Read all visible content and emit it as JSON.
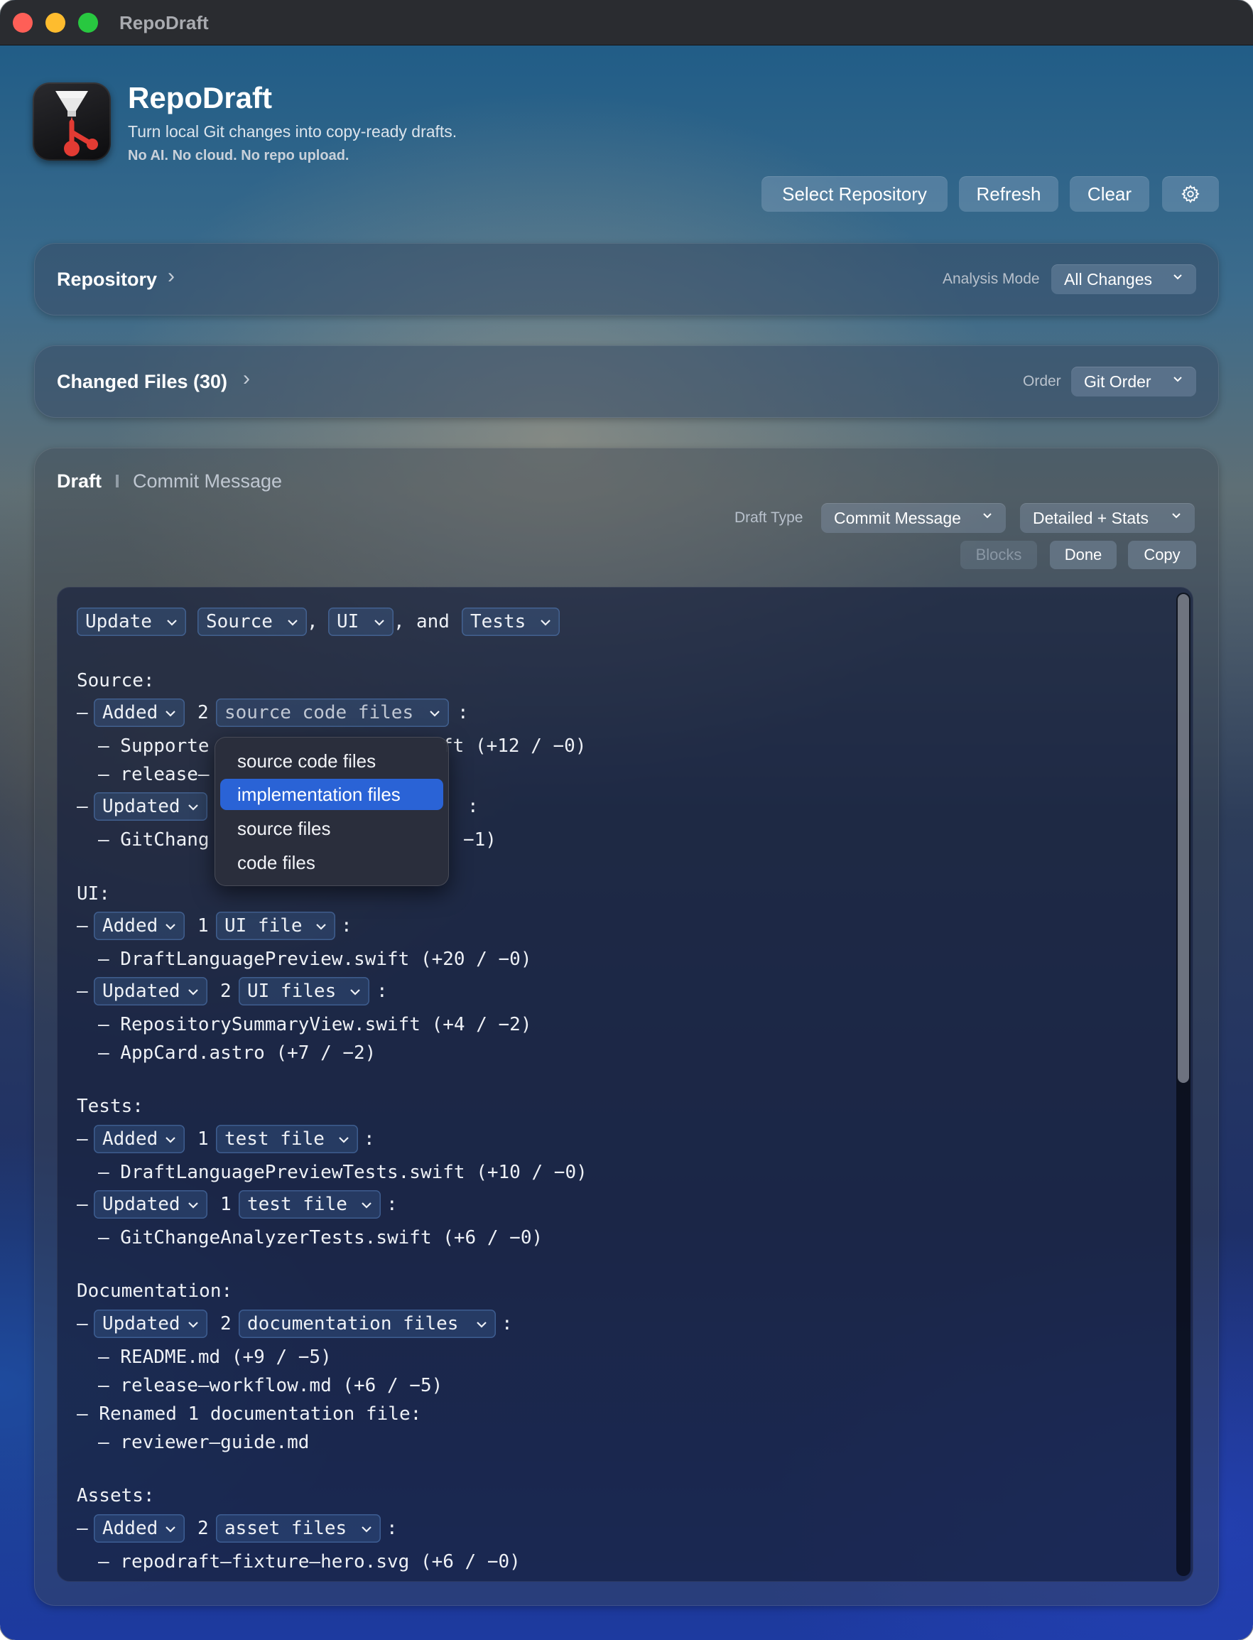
{
  "window": {
    "title": "RepoDraft"
  },
  "header": {
    "app_name": "RepoDraft",
    "tagline": "Turn local Git changes into copy-ready drafts.",
    "subtagline": "No AI. No cloud. No repo upload.",
    "buttons": {
      "select_repository": "Select Repository",
      "refresh": "Refresh",
      "clear": "Clear",
      "settings_icon": "gear-icon"
    }
  },
  "repository": {
    "title": "Repository",
    "analysis_mode_label": "Analysis Mode",
    "analysis_mode_value": "All Changes"
  },
  "changed_files": {
    "title": "Changed Files (30)",
    "order_label": "Order",
    "order_value": "Git Order"
  },
  "draft": {
    "title": "Draft",
    "subtitle": "Commit Message",
    "draft_type_label": "Draft Type",
    "draft_type_value": "Commit Message",
    "detail_value": "Detailed + Stats",
    "buttons": {
      "blocks": "Blocks",
      "done": "Done",
      "copy": "Copy"
    }
  },
  "editor": {
    "summary": {
      "verb": "Update",
      "t1": "Source",
      "c1": ",",
      "t2": "UI",
      "c2": ",",
      "and": "and",
      "t3": "Tests"
    },
    "source": {
      "heading": "Source:",
      "added": {
        "dash": "–",
        "verb": "Added",
        "count": "2",
        "kind": "source code files",
        "colon": ":"
      },
      "added_files": [
        "– Supporte",
        "ft (+12 / −0)",
        "– release–"
      ],
      "updated": {
        "dash": "–",
        "verb": "Updated",
        "colon": ":"
      },
      "updated_files": [
        "– GitChang",
        "−1)"
      ]
    },
    "ui": {
      "heading": "UI:",
      "added": {
        "dash": "–",
        "verb": "Added",
        "count": "1",
        "kind": "UI file",
        "colon": ":"
      },
      "added_files": [
        "– DraftLanguagePreview.swift (+20 / −0)"
      ],
      "updated": {
        "dash": "–",
        "verb": "Updated",
        "count": "2",
        "kind": "UI files",
        "colon": ":"
      },
      "updated_files": [
        "– RepositorySummaryView.swift (+4 / −2)",
        "– AppCard.astro (+7 / −2)"
      ]
    },
    "tests": {
      "heading": "Tests:",
      "added": {
        "dash": "–",
        "verb": "Added",
        "count": "1",
        "kind": "test file",
        "colon": ":"
      },
      "added_files": [
        "– DraftLanguagePreviewTests.swift (+10 / −0)"
      ],
      "updated": {
        "dash": "–",
        "verb": "Updated",
        "count": "1",
        "kind": "test file",
        "colon": ":"
      },
      "updated_files": [
        "– GitChangeAnalyzerTests.swift (+6 / −0)"
      ]
    },
    "documentation": {
      "heading": "Documentation:",
      "updated": {
        "dash": "–",
        "verb": "Updated",
        "count": "2",
        "kind": "documentation files",
        "colon": ":"
      },
      "updated_files": [
        "– README.md (+9 / −5)",
        "– release–workflow.md (+6 / −5)"
      ],
      "renamed": "– Renamed 1 documentation file:",
      "renamed_files": [
        "– reviewer–guide.md"
      ]
    },
    "assets": {
      "heading": "Assets:",
      "added": {
        "dash": "–",
        "verb": "Added",
        "count": "2",
        "kind": "asset files",
        "colon": ":"
      },
      "added_files": [
        "– repodraft–fixture–hero.svg (+6 / −0)"
      ]
    }
  },
  "dropdown": {
    "options": [
      "source code files",
      "implementation files",
      "source files",
      "code files"
    ],
    "highlighted": "implementation files"
  },
  "colors": {
    "accent": "#2a63d6",
    "close": "#fe5f57",
    "minimize": "#febc2e",
    "zoom": "#28c840"
  }
}
